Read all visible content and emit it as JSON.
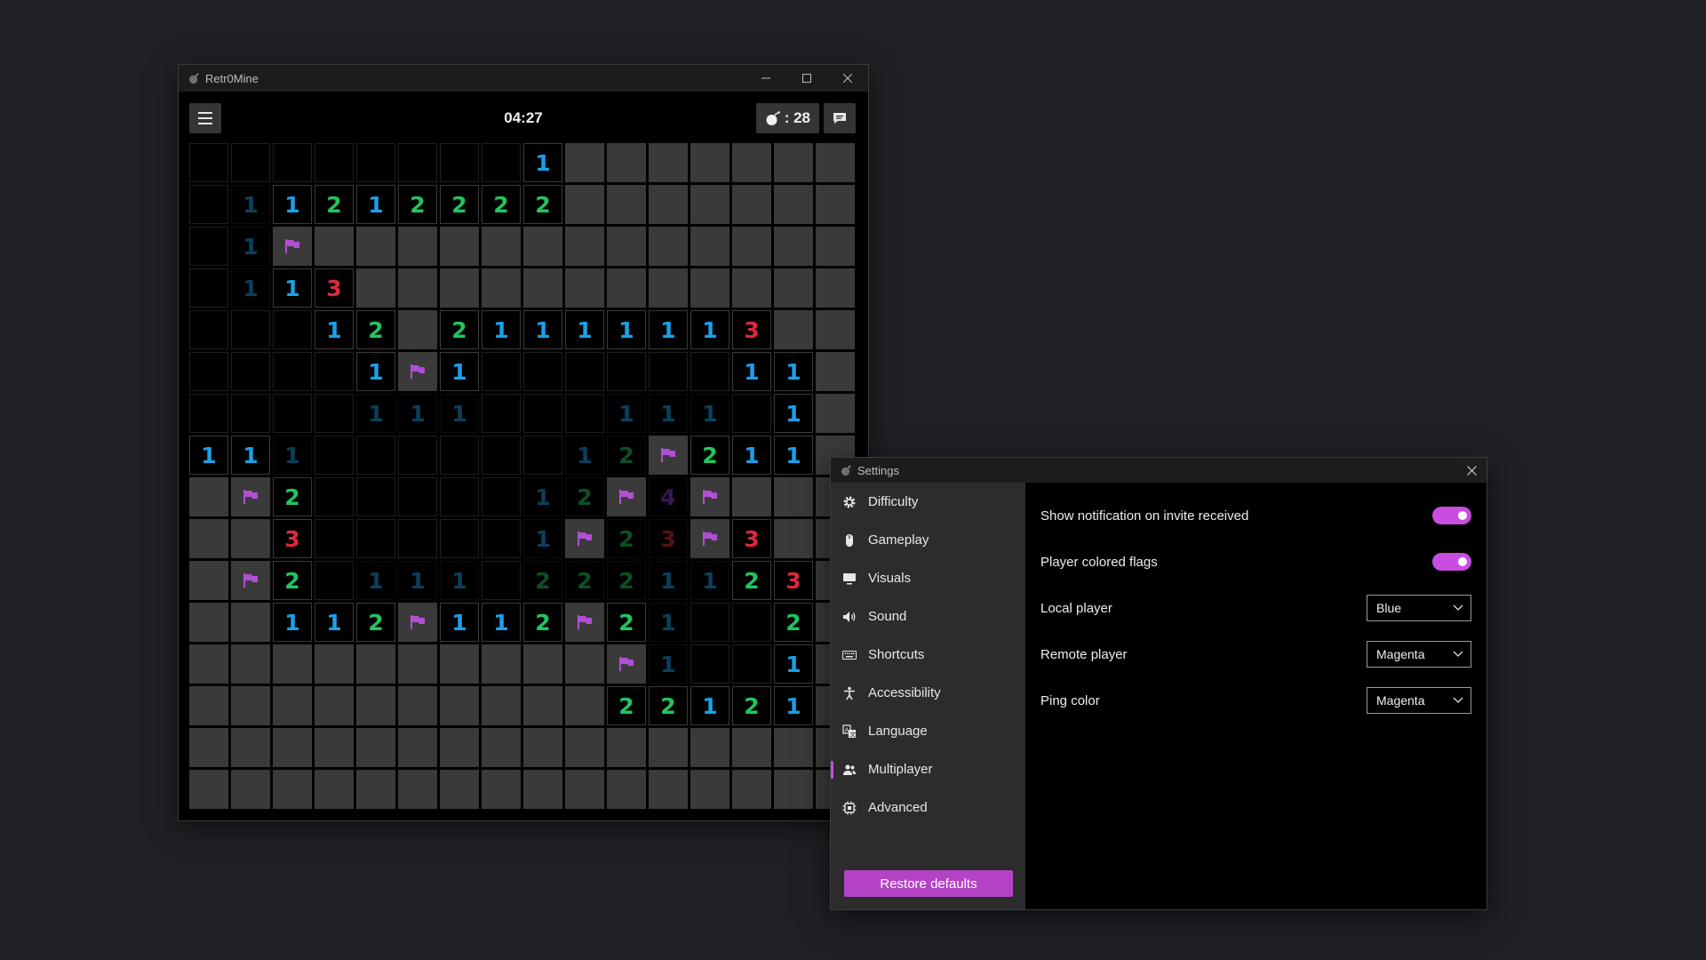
{
  "game": {
    "title": "Retr0Mine",
    "timer": "04:27",
    "mines_left": ": 28",
    "board": [
      [
        "",
        "",
        "",
        "",
        "",
        "",
        "",
        "",
        "1",
        "#",
        "#",
        "#",
        "#",
        "#",
        "#",
        "#"
      ],
      [
        "",
        "~1",
        "1",
        "2",
        "1",
        "2",
        "2",
        "2",
        "2",
        "#",
        "#",
        "#",
        "#",
        "#",
        "#",
        "#"
      ],
      [
        "",
        "~1",
        "F",
        "#",
        "#",
        "#",
        "#",
        "#",
        "#",
        "#",
        "#",
        "#",
        "#",
        "#",
        "#",
        "#"
      ],
      [
        "",
        "~1",
        "1",
        "3",
        "#",
        "#",
        "#",
        "#",
        "#",
        "#",
        "#",
        "#",
        "#",
        "#",
        "#",
        "#"
      ],
      [
        "",
        "",
        "",
        "1",
        "2",
        "#",
        "2",
        "1",
        "1",
        "1",
        "1",
        "1",
        "1",
        "3",
        "#",
        "#"
      ],
      [
        "",
        "",
        "",
        "",
        "1",
        "F",
        "1",
        "",
        "",
        "",
        "",
        "",
        "",
        "1",
        "1",
        "#"
      ],
      [
        "",
        "",
        "",
        "",
        "~1",
        "~1",
        "~1",
        "",
        "",
        "",
        "~1",
        "~1",
        "~1",
        "",
        "1",
        "#"
      ],
      [
        "1",
        "1",
        "~1",
        "",
        "",
        "",
        "",
        "",
        "",
        "~1",
        "~2",
        "F",
        "2",
        "1",
        "1",
        "#"
      ],
      [
        "#",
        "F",
        "2",
        "",
        "",
        "",
        "",
        "",
        "~1",
        "~2",
        "F",
        "~4",
        "F",
        "#",
        "#",
        "#"
      ],
      [
        "#",
        "#",
        "3",
        "",
        "",
        "",
        "",
        "",
        "~1",
        "F",
        "~2",
        "~3",
        "F",
        "3",
        "#",
        "#"
      ],
      [
        "#",
        "F",
        "2",
        "",
        "~1",
        "~1",
        "~1",
        "",
        "~2",
        "~2",
        "~2",
        "~1",
        "~1",
        "2",
        "3",
        "#"
      ],
      [
        "#",
        "#",
        "1",
        "1",
        "2",
        "F",
        "1",
        "1",
        "2",
        "F",
        "2",
        "~1",
        "",
        "",
        "2",
        "#"
      ],
      [
        "#",
        "#",
        "#",
        "#",
        "#",
        "#",
        "#",
        "#",
        "#",
        "#",
        "F",
        "~1",
        "",
        "",
        "1",
        "#"
      ],
      [
        "#",
        "#",
        "#",
        "#",
        "#",
        "#",
        "#",
        "#",
        "#",
        "#",
        "2",
        "2",
        "1",
        "2",
        "1",
        "#"
      ],
      [
        "#",
        "#",
        "#",
        "#",
        "#",
        "#",
        "#",
        "#",
        "#",
        "#",
        "#",
        "#",
        "#",
        "#",
        "#",
        "#"
      ],
      [
        "#",
        "#",
        "#",
        "#",
        "#",
        "#",
        "#",
        "#",
        "#",
        "#",
        "#",
        "#",
        "#",
        "#",
        "#",
        "#"
      ]
    ]
  },
  "colors": {
    "accent": "#c94de0",
    "n1": "#1ca0e8",
    "n2": "#22c55e",
    "n3": "#e0283c",
    "n4": "#8b3fc8",
    "flag": "#b04fd4",
    "hidden": "#3a3a3a"
  },
  "settings": {
    "title": "Settings",
    "nav": [
      {
        "label": "Difficulty",
        "icon": "gear-icon"
      },
      {
        "label": "Gameplay",
        "icon": "mouse-icon"
      },
      {
        "label": "Visuals",
        "icon": "monitor-icon"
      },
      {
        "label": "Sound",
        "icon": "speaker-icon"
      },
      {
        "label": "Shortcuts",
        "icon": "keyboard-icon"
      },
      {
        "label": "Accessibility",
        "icon": "accessibility-icon"
      },
      {
        "label": "Language",
        "icon": "translate-icon"
      },
      {
        "label": "Multiplayer",
        "icon": "people-icon"
      },
      {
        "label": "Advanced",
        "icon": "chip-icon"
      }
    ],
    "active_nav": "Multiplayer",
    "rows": {
      "notify_invite": {
        "label": "Show notification on invite received",
        "on": true
      },
      "colored_flags": {
        "label": "Player colored flags",
        "on": true
      },
      "local_player": {
        "label": "Local player",
        "value": "Blue"
      },
      "remote_player": {
        "label": "Remote player",
        "value": "Magenta"
      },
      "ping_color": {
        "label": "Ping color",
        "value": "Magenta"
      }
    },
    "restore_label": "Restore defaults"
  }
}
